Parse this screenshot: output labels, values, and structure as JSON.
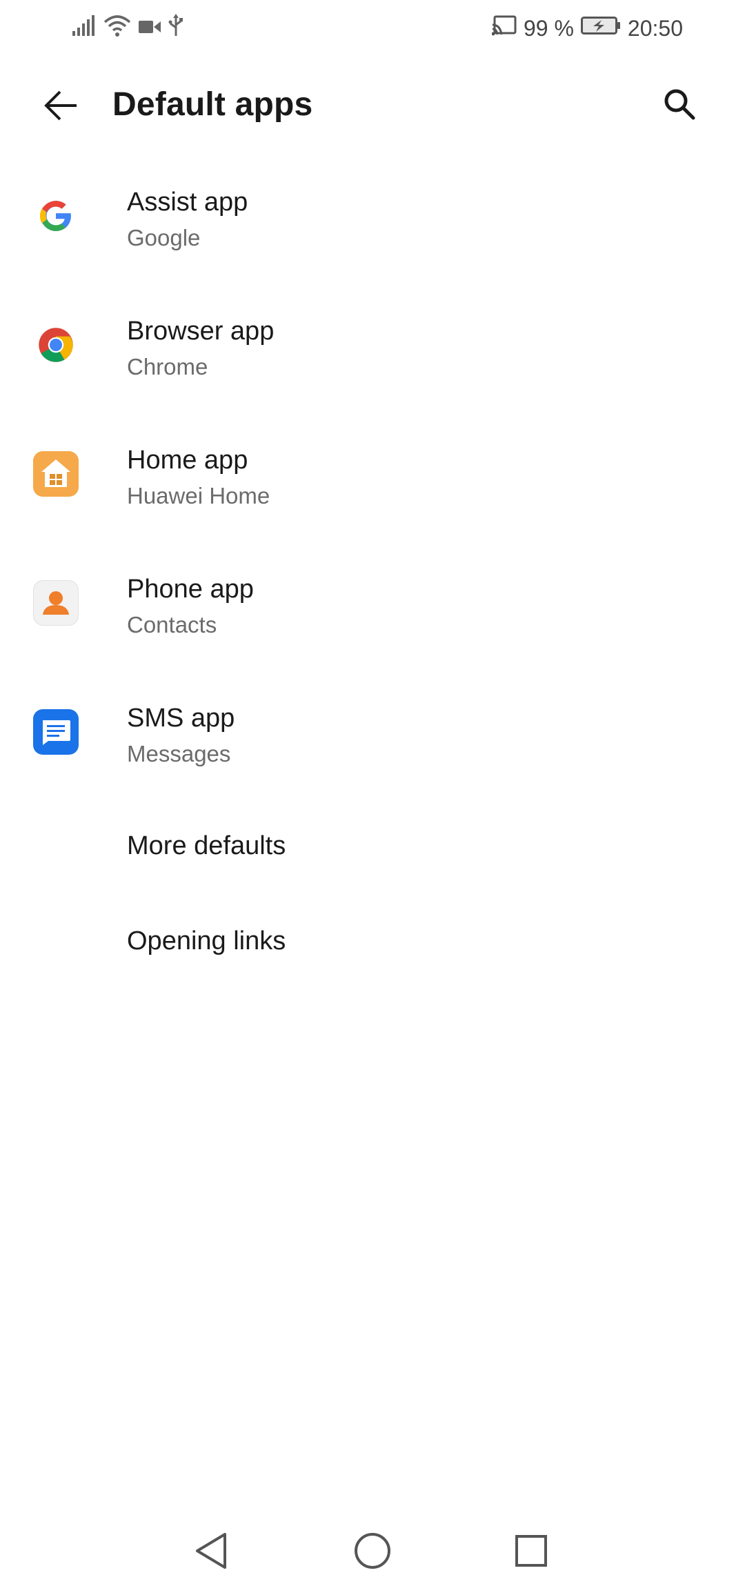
{
  "status_bar": {
    "battery_percent": "99 %",
    "time": "20:50",
    "icons_left": [
      "signal-icon",
      "wifi-icon",
      "video-icon",
      "usb-icon"
    ],
    "icons_right": [
      "cast-icon",
      "battery-charging-icon"
    ]
  },
  "app_bar": {
    "title": "Default apps"
  },
  "items": [
    {
      "title": "Assist app",
      "subtitle": "Google",
      "icon": "google-icon"
    },
    {
      "title": "Browser app",
      "subtitle": "Chrome",
      "icon": "chrome-icon"
    },
    {
      "title": "Home app",
      "subtitle": "Huawei Home",
      "icon": "huawei-home-icon"
    },
    {
      "title": "Phone app",
      "subtitle": "Contacts",
      "icon": "contacts-icon"
    },
    {
      "title": "SMS app",
      "subtitle": "Messages",
      "icon": "messages-icon"
    }
  ],
  "plain_items": [
    {
      "title": "More defaults"
    },
    {
      "title": "Opening links"
    }
  ],
  "colors": {
    "title_text": "#1a1a1a",
    "subtitle_text": "#6b6b6b",
    "home_icon_bg": "#f5a94a",
    "messages_icon_bg": "#1a73e8",
    "contacts_icon_fg": "#ef7f2a"
  },
  "nav_bar": {
    "icons": [
      "back-triangle-icon",
      "home-circle-icon",
      "recents-square-icon"
    ]
  }
}
